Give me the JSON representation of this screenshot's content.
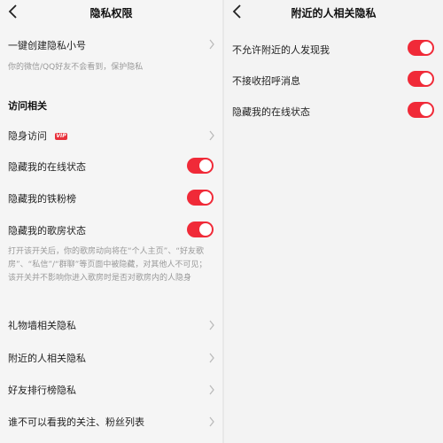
{
  "left": {
    "title": "隐私权限",
    "one_key_label": "一键创建隐私小号",
    "one_key_sub": "你的微信/QQ好友不会看到，保护隐私",
    "section_access": "访问相关",
    "invisible_visit": "隐身访问",
    "vip_badge": "VIP",
    "hide_online": "隐藏我的在线状态",
    "hide_fans": "隐藏我的铁粉榜",
    "hide_room": "隐藏我的歌房状态",
    "room_desc": "打开该开关后，你的歌房动向将在“个人主页”、“好友歌房”、“私信”/“群聊”等页面中被隐藏，对其他人不可见；该开关并不影响你进入歌房时是否对歌房内的人隐身",
    "gift_wall": "礼物墙相关隐私",
    "nearby": "附近的人相关隐私",
    "friend_rank": "好友排行榜隐私",
    "who_cannot": "谁不可以看我的关注、粉丝列表"
  },
  "right": {
    "title": "附近的人相关隐私",
    "no_discover": "不允许附近的人发现我",
    "no_greet": "不接收招呼消息",
    "hide_online": "隐藏我的在线状态"
  },
  "colors": {
    "toggle_on": "#f02a38",
    "vip": "#e8313b"
  },
  "toggles": {
    "left_hide_online": true,
    "left_hide_fans": true,
    "left_hide_room": true,
    "right_no_discover": true,
    "right_no_greet": true,
    "right_hide_online": true
  }
}
